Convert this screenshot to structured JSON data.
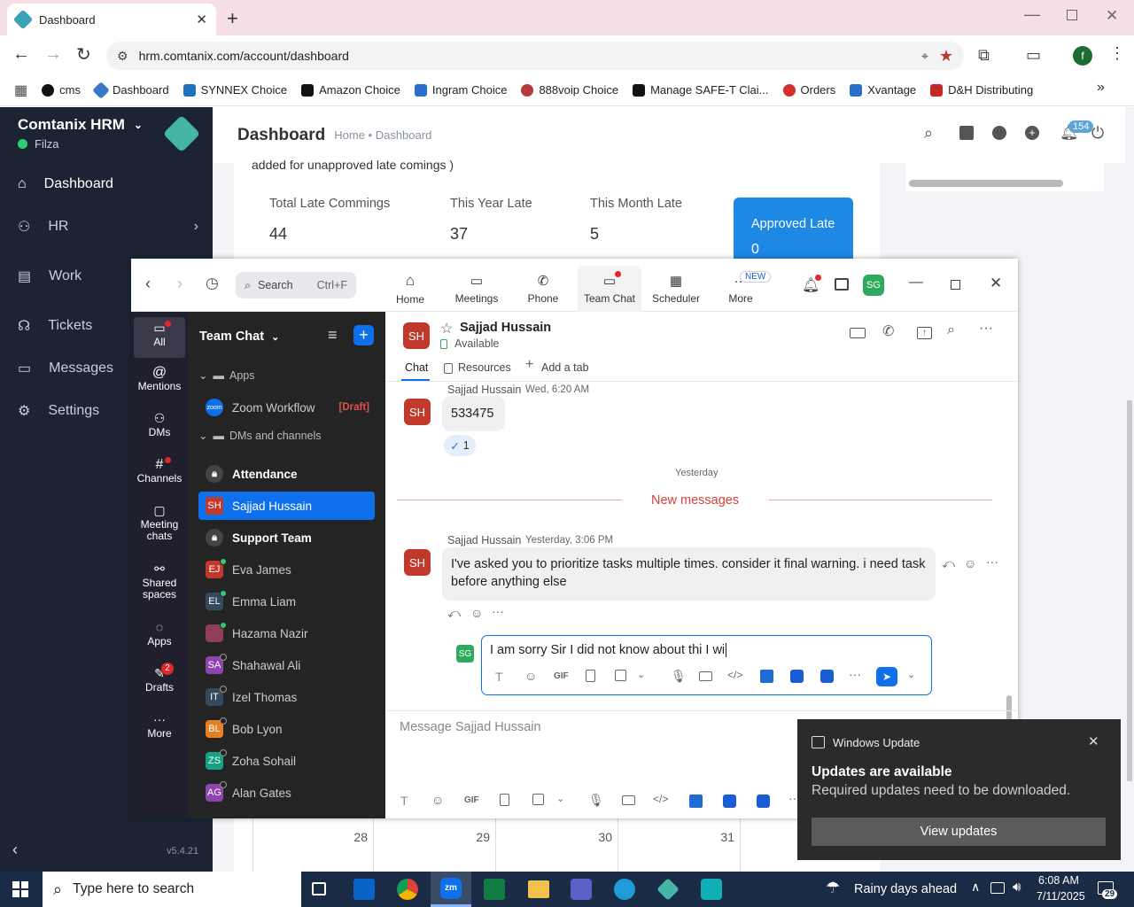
{
  "browser": {
    "tab_title": "Dashboard",
    "url": "hrm.comtanix.com/account/dashboard",
    "profile_initial": "f",
    "bookmarks": [
      {
        "label": "cms",
        "color": "#111111"
      },
      {
        "label": "Dashboard",
        "color": "#3a79c7"
      },
      {
        "label": "SYNNEX Choice",
        "color": "#1e73be"
      },
      {
        "label": "Amazon Choice",
        "color": "#111111"
      },
      {
        "label": "Ingram Choice",
        "color": "#2a6fcf"
      },
      {
        "label": "888voip Choice",
        "color": "#b23b3b"
      },
      {
        "label": "Manage SAFE-T Clai...",
        "color": "#111111"
      },
      {
        "label": "Orders",
        "color": "#d32f2f"
      },
      {
        "label": "Xvantage",
        "color": "#2a6fcf"
      },
      {
        "label": "D&H Distributing",
        "color": "#c62828"
      }
    ]
  },
  "hrm": {
    "brand": "Comtanix HRM",
    "user": "Filza",
    "nav": [
      "Dashboard",
      "HR",
      "Work",
      "Tickets",
      "Messages",
      "Settings"
    ],
    "version": "v5.4.21",
    "page_title": "Dashboard",
    "breadcrumb": "Home • Dashboard",
    "notification_count": "154",
    "note_text": "added for unapproved late comings )",
    "stats": [
      {
        "label": "Total Late Commings",
        "value": "44"
      },
      {
        "label": "This Year Late",
        "value": "37"
      },
      {
        "label": "This Month Late",
        "value": "5"
      }
    ],
    "approved": {
      "label": "Approved Late",
      "value": "0"
    },
    "calendar_days": [
      "28",
      "29",
      "30",
      "31"
    ]
  },
  "zoom": {
    "search_label": "Search",
    "search_shortcut": "Ctrl+F",
    "tabs": [
      "Home",
      "Meetings",
      "Phone",
      "Team Chat",
      "Scheduler",
      "More"
    ],
    "new_badge": "NEW",
    "user_initials": "SG",
    "rail": [
      {
        "label": "All"
      },
      {
        "label": "Mentions"
      },
      {
        "label": "DMs"
      },
      {
        "label": "Channels"
      },
      {
        "label": "Meeting chats"
      },
      {
        "label": "Shared spaces"
      },
      {
        "label": "Apps"
      },
      {
        "label": "Drafts",
        "badge": "2"
      },
      {
        "label": "More"
      }
    ],
    "list_title": "Team Chat",
    "section_apps": "Apps",
    "zoom_workflow": "Zoom Workflow",
    "draft_tag": "[Draft]",
    "section_dms": "DMs and channels",
    "contacts": [
      {
        "name": "Attendance",
        "initials": "",
        "color": "#444",
        "bold": true
      },
      {
        "name": "Sajjad Hussain",
        "initials": "SH",
        "color": "#c0392b"
      },
      {
        "name": "Support Team",
        "initials": "",
        "color": "#444",
        "bold": true
      },
      {
        "name": "Eva James",
        "initials": "EJ",
        "color": "#c0392b"
      },
      {
        "name": "Emma Liam",
        "initials": "EL",
        "color": "#34495e"
      },
      {
        "name": "Hazama Nazir",
        "initials": "",
        "color": "#8e3d5a"
      },
      {
        "name": "Shahawal Ali",
        "initials": "SA",
        "color": "#8e44ad"
      },
      {
        "name": "Izel Thomas",
        "initials": "IT",
        "color": "#34495e"
      },
      {
        "name": "Bob Lyon",
        "initials": "BL",
        "color": "#e67e22"
      },
      {
        "name": "Zoha Sohail",
        "initials": "ZS",
        "color": "#16a085"
      },
      {
        "name": "Alan Gates",
        "initials": "AG",
        "color": "#8e44ad"
      }
    ],
    "chat": {
      "contact_initials": "SH",
      "contact_name": "Sajjad Hussain",
      "status": "Available",
      "subtabs": [
        "Chat",
        "Resources",
        "Add a tab"
      ],
      "msg1_sender": "Sajjad Hussain",
      "msg1_time": "Wed, 6:20 AM",
      "msg1_text": "533475",
      "reaction": "1",
      "divider_yesterday": "Yesterday",
      "divider_new": "New messages",
      "msg2_sender": "Sajjad Hussain",
      "msg2_time": "Yesterday, 3:06 PM",
      "msg2_text": "I've asked you to prioritize tasks multiple times. consider it final warning. i need task before anything else",
      "reply_initials": "SG",
      "reply_text": "I am sorry Sir I did not know about thi I wi",
      "compose_placeholder": "Message Sajjad Hussain",
      "gif_label": "GIF"
    }
  },
  "toast": {
    "app": "Windows Update",
    "title": "Updates are available",
    "body": "Required updates need to be downloaded.",
    "button": "View updates"
  },
  "taskbar": {
    "search_placeholder": "Type here to search",
    "weather": "Rainy days ahead",
    "time": "6:08 AM",
    "date": "7/11/2025",
    "notification_count": "29"
  }
}
